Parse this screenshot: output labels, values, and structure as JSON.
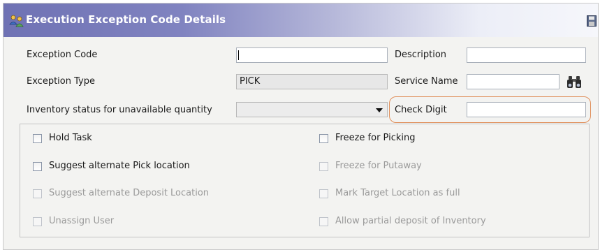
{
  "window": {
    "title": "Execution Exception Code Details",
    "icons": {
      "title_icon": "people-icon",
      "save_icon": "save-icon"
    }
  },
  "form": {
    "exception_code": {
      "label": "Exception Code",
      "value": ""
    },
    "description": {
      "label": "Description",
      "value": ""
    },
    "exception_type": {
      "label": "Exception Type",
      "value": "PICK"
    },
    "service_name": {
      "label": "Service Name",
      "value": "",
      "lookup_icon": "binoculars-icon"
    },
    "inventory_status": {
      "label": "Inventory status for unavailable quantity",
      "selected": ""
    },
    "check_digit": {
      "label": "Check Digit",
      "value": ""
    }
  },
  "options": [
    {
      "label": "Hold Task",
      "checked": false,
      "enabled": true
    },
    {
      "label": "Freeze for Picking",
      "checked": false,
      "enabled": true
    },
    {
      "label": "Suggest alternate Pick location",
      "checked": false,
      "enabled": true
    },
    {
      "label": "Freeze for Putaway",
      "checked": false,
      "enabled": false
    },
    {
      "label": "Suggest alternate Deposit Location",
      "checked": false,
      "enabled": false
    },
    {
      "label": "Mark Target Location as full",
      "checked": false,
      "enabled": false
    },
    {
      "label": "Unassign User",
      "checked": false,
      "enabled": false
    },
    {
      "label": "Allow partial deposit of Inventory",
      "checked": false,
      "enabled": false
    }
  ],
  "colors": {
    "title_gradient_start": "#6f72b4",
    "highlight_border": "#e0905c",
    "disabled_text": "#9a9a9a"
  }
}
